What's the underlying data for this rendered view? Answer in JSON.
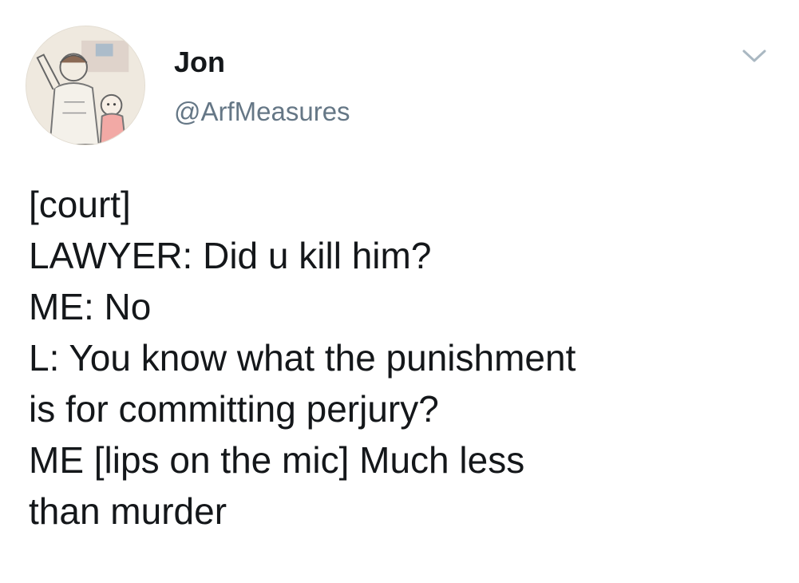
{
  "author": {
    "display_name": "Jon",
    "handle": "@ArfMeasures",
    "avatar_icon": "cartoon-avatar-icon"
  },
  "menu": {
    "icon": "chevron-down-icon"
  },
  "tweet": {
    "lines": [
      "[court]",
      "LAWYER: Did u kill him?",
      "ME: No",
      "L: You know what the punishment",
      "is for committing perjury?",
      "ME [lips on the mic] Much less",
      "than murder"
    ]
  },
  "colors": {
    "text": "#14171a",
    "handle": "#657786",
    "caret": "#aab8c2"
  }
}
